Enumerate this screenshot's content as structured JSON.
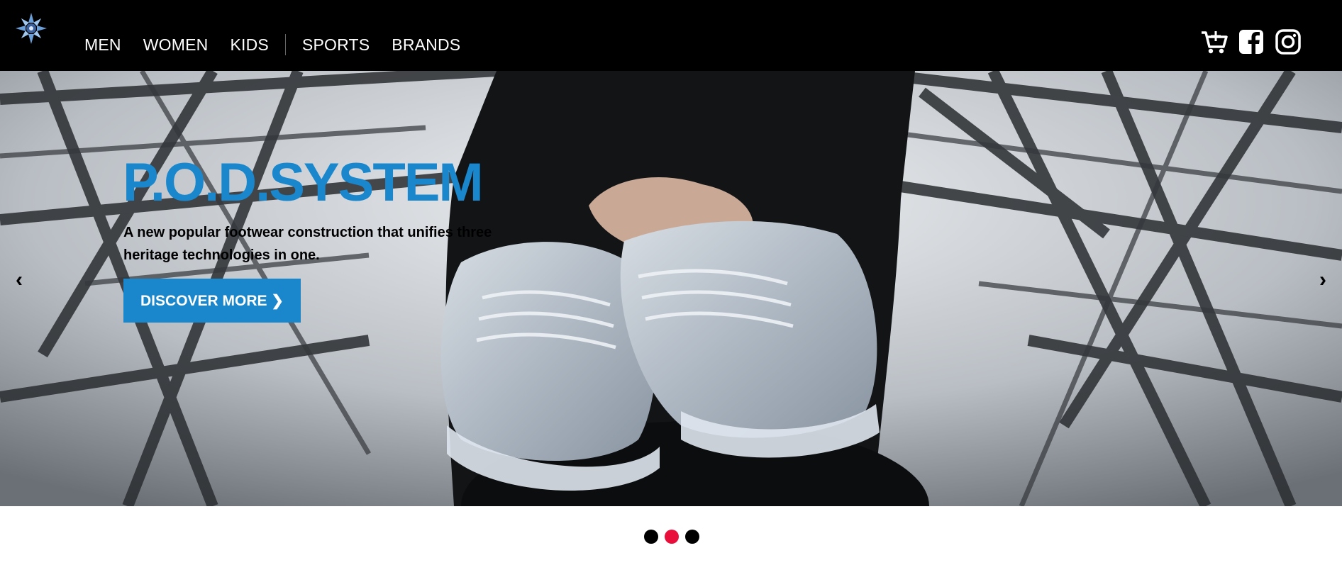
{
  "header": {
    "nav": [
      {
        "label": "MEN"
      },
      {
        "label": "WOMEN"
      },
      {
        "label": "KIDS"
      },
      {
        "label": "SPORTS"
      },
      {
        "label": "BRANDS"
      }
    ],
    "icons": [
      "cart-plus-icon",
      "facebook-icon",
      "instagram-icon"
    ]
  },
  "hero": {
    "title": "P.O.D.SYSTEM",
    "description": "A new popular footwear construction that unifies three heritage technologies in one.",
    "cta_label": "DISCOVER MORE ❯",
    "prev_label": "‹",
    "next_label": "›",
    "accent_color": "#1a87cd"
  },
  "carousel": {
    "slide_count": 3,
    "active_index": 1,
    "active_color": "#e8103a"
  }
}
